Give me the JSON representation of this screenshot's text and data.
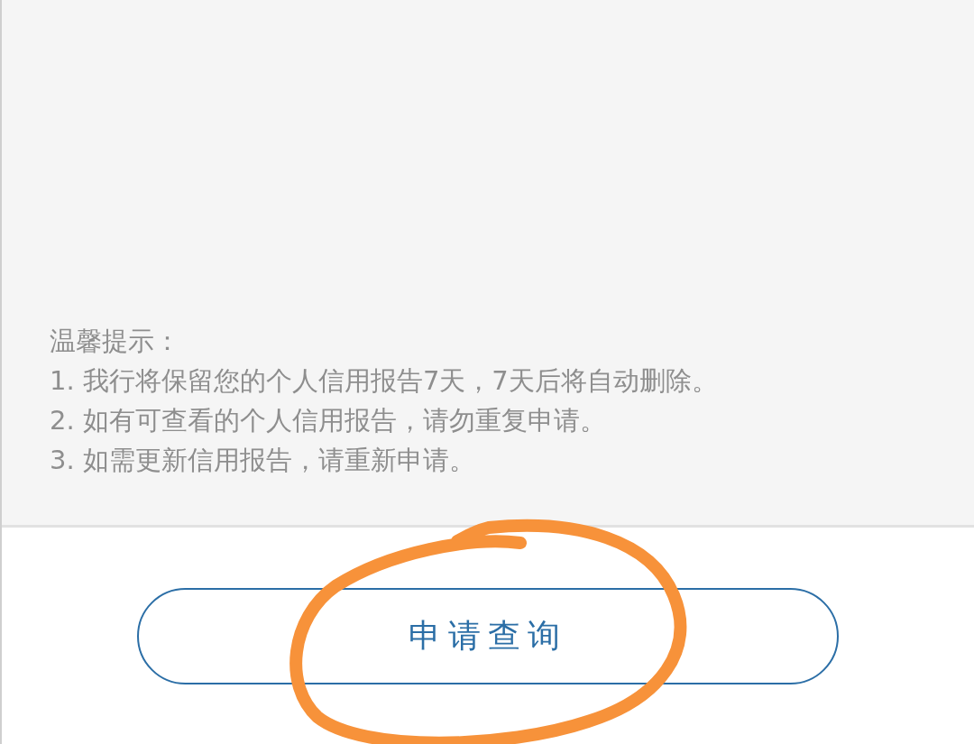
{
  "tips": {
    "title": "温馨提示：",
    "items": [
      "1. 我行将保留您的个人信用报告7天，7天后将自动删除。",
      "2. 如有可查看的个人信用报告，请勿重复申请。",
      "3. 如需更新信用报告，请重新申请。"
    ]
  },
  "button": {
    "label": "申请查询"
  },
  "annotation": {
    "kind": "circle"
  }
}
